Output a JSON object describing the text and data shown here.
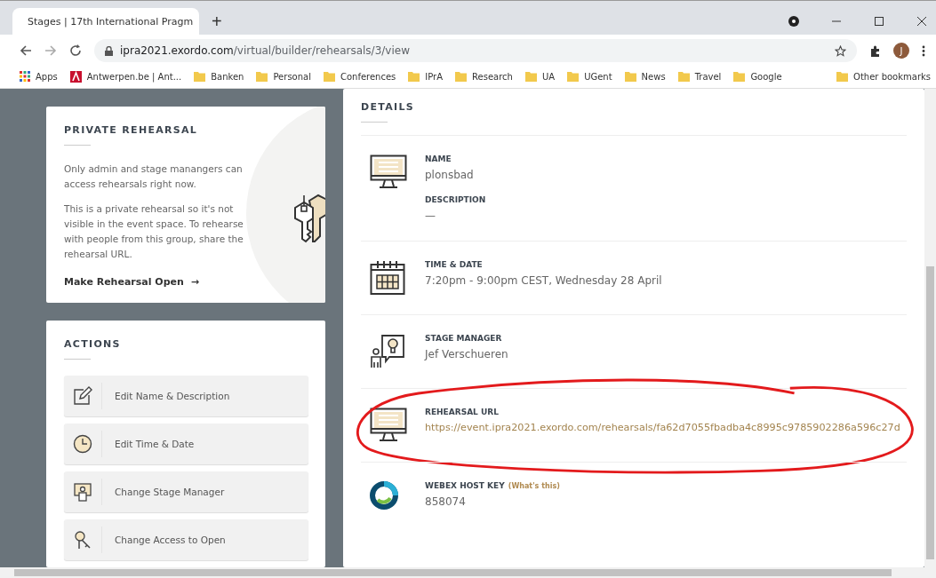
{
  "browser": {
    "tab_title": "Stages | 17th International Pragm",
    "new_tab": "+",
    "url_host": "ipra2021.exordo.com",
    "url_path": "/virtual/builder/rehearsals/3/view",
    "avatar": "J",
    "bookmarks": [
      {
        "label": "Apps",
        "kind": "apps"
      },
      {
        "label": "Antwerpen.be | Ant...",
        "kind": "site"
      },
      {
        "label": "Banken",
        "kind": "folder"
      },
      {
        "label": "Personal",
        "kind": "folder"
      },
      {
        "label": "Conferences",
        "kind": "folder"
      },
      {
        "label": "IPrA",
        "kind": "folder"
      },
      {
        "label": "Research",
        "kind": "folder"
      },
      {
        "label": "UA",
        "kind": "folder"
      },
      {
        "label": "UGent",
        "kind": "folder"
      },
      {
        "label": "News",
        "kind": "folder"
      },
      {
        "label": "Travel",
        "kind": "folder"
      },
      {
        "label": "Google",
        "kind": "folder"
      }
    ],
    "other_bookmarks": "Other bookmarks"
  },
  "private_card": {
    "title": "PRIVATE REHEARSAL",
    "paragraphs": [
      "Only admin and stage manangers can access rehearsals right now.",
      "This is a private rehearsal so it's not visible in the event space. To rehearse with people from this group, share the rehearsal URL."
    ],
    "link": "Make Rehearsal Open",
    "link_arrow": "→"
  },
  "actions": {
    "title": "ACTIONS",
    "items": [
      {
        "label": "Edit Name & Description",
        "kind": "edit"
      },
      {
        "label": "Edit Time & Date",
        "kind": "clock"
      },
      {
        "label": "Change Stage Manager",
        "kind": "manager"
      },
      {
        "label": "Change Access to Open",
        "kind": "keys"
      }
    ]
  },
  "details": {
    "title": "DETAILS",
    "rows": [
      {
        "kind": "monitor",
        "fields": [
          {
            "label": "NAME",
            "value": "plonsbad",
            "kind": "text"
          },
          {
            "label": "DESCRIPTION",
            "value": "—",
            "kind": "text"
          }
        ]
      },
      {
        "kind": "calendar",
        "fields": [
          {
            "label": "TIME & DATE",
            "value": "7:20pm - 9:00pm CEST, Wednesday 28 April",
            "kind": "text"
          }
        ]
      },
      {
        "kind": "manager",
        "fields": [
          {
            "label": "STAGE MANAGER",
            "value": "Jef Verschueren",
            "kind": "text"
          }
        ]
      },
      {
        "kind": "monitor",
        "annotated": true,
        "fields": [
          {
            "label": "REHEARSAL URL",
            "value": "https://event.ipra2021.exordo.com/rehearsals/fa62d7055fbadba4c8995c9785902286a596c27d",
            "kind": "link"
          }
        ]
      },
      {
        "kind": "webex",
        "fields": [
          {
            "label": "WEBEX HOST KEY",
            "help": "(What's this)",
            "value": "858074",
            "kind": "text"
          }
        ]
      }
    ]
  }
}
